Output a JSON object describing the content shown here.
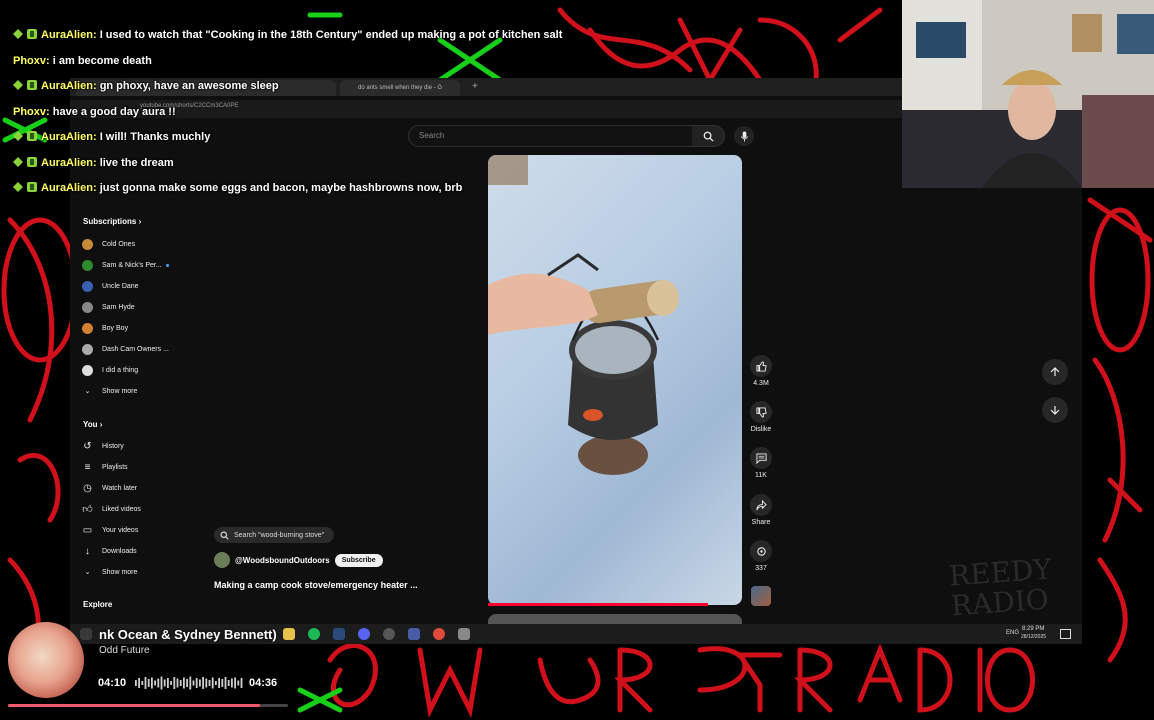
{
  "chat": [
    {
      "user": "AuraAlien:",
      "message": "I used to watch that \"Cooking in the 18th Century\" ended up making a pot of kitchen salt",
      "badges": true
    },
    {
      "user": "Phoxv:",
      "message": "i am become death",
      "badges": false
    },
    {
      "user": "AuraAlien:",
      "message": "gn phoxy, have an awesome sleep",
      "badges": true
    },
    {
      "user": "Phoxv:",
      "message": "have a good day aura !!",
      "badges": false
    },
    {
      "user": "AuraAlien:",
      "message": "I will! Thanks muchly",
      "badges": true
    },
    {
      "user": "AuraAlien:",
      "message": "live the dream",
      "badges": true
    },
    {
      "user": "AuraAlien:",
      "message": "just gonna make some eggs and bacon, maybe hashbrowns now, brb",
      "badges": true
    }
  ],
  "browser": {
    "tabs": [
      "do ants smell when they die - G"
    ],
    "url": "youtube.com/shorts/C2CCm3CA0PE",
    "search_placeholder": "Search"
  },
  "sidebar": {
    "subscriptions_label": "Subscriptions",
    "subscriptions": [
      {
        "name": "Cold Ones",
        "color": "#c98a3a",
        "dot": false
      },
      {
        "name": "Sam & Nick's Per...",
        "color": "#2e8b2e",
        "dot": true
      },
      {
        "name": "Uncle Dane",
        "color": "#3a5fb0",
        "dot": false
      },
      {
        "name": "Sam Hyde",
        "color": "#888888",
        "dot": false
      },
      {
        "name": "Boy Boy",
        "color": "#d08030",
        "dot": false
      },
      {
        "name": "Dash Cam Owners ...",
        "color": "#aaaaaa",
        "dot": false
      },
      {
        "name": "I did a thing",
        "color": "#dddddd",
        "dot": false
      }
    ],
    "show_more": "Show more",
    "you_label": "You",
    "you_items": [
      {
        "name": "History",
        "icon": "history-icon"
      },
      {
        "name": "Playlists",
        "icon": "playlists-icon"
      },
      {
        "name": "Watch later",
        "icon": "watch-later-icon"
      },
      {
        "name": "Liked videos",
        "icon": "like-icon"
      },
      {
        "name": "Your videos",
        "icon": "your-videos-icon"
      },
      {
        "name": "Downloads",
        "icon": "download-icon"
      }
    ],
    "show_more_2": "Show more",
    "explore_label": "Explore"
  },
  "short": {
    "search_chip": "Search \"wood-burning stove\"",
    "channel": "@WoodsboundOutdoors",
    "subscribe": "Subscribe",
    "title": "Making a camp cook stove/emergency heater ...",
    "likes": "4.3M",
    "dislike": "Dislike",
    "comments": "11K",
    "share": "Share",
    "remix": "337"
  },
  "taskbar": {
    "time": "8:29 PM",
    "date": "28/12/2025",
    "lang": "ENG"
  },
  "music": {
    "title": "nk Ocean & Sydney Bennett)",
    "artist": "Odd Future",
    "current": "04:10",
    "duration": "04:36",
    "progress": 0.9
  },
  "watermark": {
    "line1": "REEDY",
    "line2": "RADIO"
  },
  "colors": {
    "accent_red": "#ff0033",
    "chat_name": "#ffff66",
    "badge_green": "#8bd33a"
  }
}
